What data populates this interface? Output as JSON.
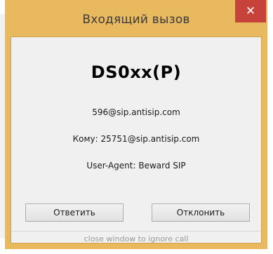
{
  "window": {
    "title": "Входящий вызов",
    "close_glyph": "✕",
    "frame_color": "#e8b95f",
    "close_color": "#c7423a"
  },
  "call": {
    "caller_name": "DS0xx(P)",
    "from": "596@sip.antisip.com",
    "to": "Кому: 25751@sip.antisip.com",
    "user_agent": "User-Agent: Beward SIP"
  },
  "buttons": {
    "answer_label": "Ответить",
    "decline_label": "Отклонить"
  },
  "footer": {
    "hint": "close window to ignore call"
  }
}
